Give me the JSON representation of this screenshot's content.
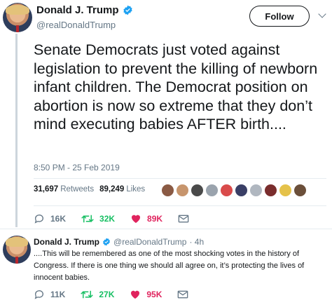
{
  "tweet": {
    "author_name": "Donald J. Trump",
    "author_handle": "@realDonaldTrump",
    "follow_label": "Follow",
    "text": "Senate Democrats just voted against legislation to prevent the killing of newborn infant children. The Democrat position on abortion is now so extreme that they don’t mind executing babies AFTER birth....",
    "timestamp": "8:50 PM - 25 Feb 2019",
    "retweets_count": "31,697",
    "retweets_label": "Retweets",
    "likes_count": "89,249",
    "likes_label": "Likes",
    "actions": {
      "replies": "16K",
      "retweets": "32K",
      "likes": "89K"
    }
  },
  "reply": {
    "author_name": "Donald J. Trump",
    "author_handle": "@realDonaldTrump",
    "age": "· 4h",
    "text": "....This will be remembered as one of the most shocking votes in the history of Congress. If there is one thing we should all agree on, it’s protecting the lives of innocent babies.",
    "actions": {
      "replies": "11K",
      "retweets": "27K",
      "likes": "95K"
    }
  },
  "colors": {
    "verified": "#1da1f2",
    "retweet": "#17bf63",
    "like": "#e0245e",
    "muted": "#657786"
  },
  "likers": [
    "#8a5a44",
    "#c7956d",
    "#4a4a4a",
    "#9aa3ad",
    "#d94b4b",
    "#3a3f66",
    "#b0b7c0",
    "#7a2d2d",
    "#e5c24a",
    "#6b4f3a"
  ]
}
